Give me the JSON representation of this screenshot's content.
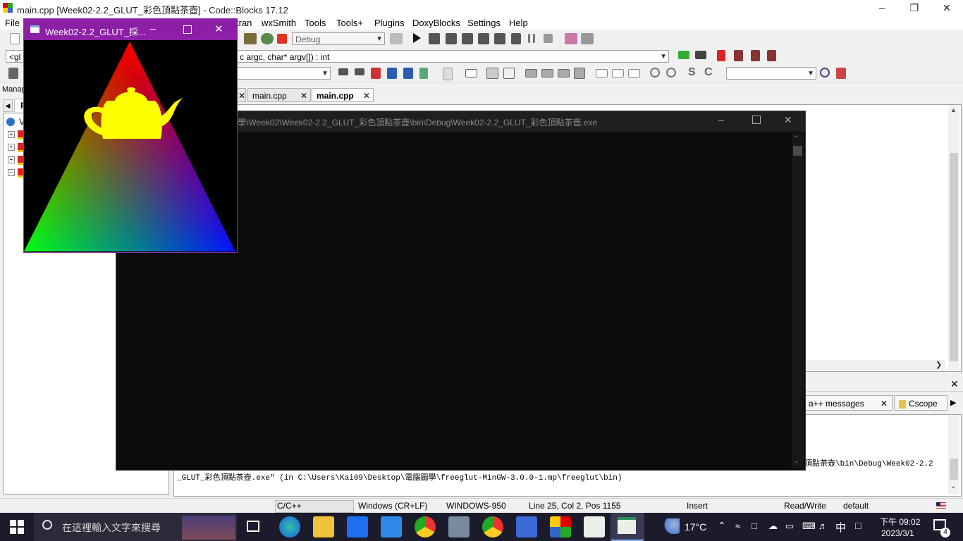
{
  "codeblocks": {
    "title": "main.cpp [Week02-2.2_GLUT_彩色頂點茶壺] - Code::Blocks 17.12",
    "menu": [
      "File",
      "tran",
      "wxSmith",
      "Tools",
      "Tools+",
      "Plugins",
      "DoxyBlocks",
      "Settings",
      "Help"
    ],
    "build_target": "Debug",
    "scope_left": "<gl",
    "function_signature": "c argc, char* argv[]) : int",
    "management_label": "Manag",
    "management_tab": "P",
    "workspace_label": "V",
    "tabs": [
      "main.cpp",
      "main.cpp"
    ],
    "logs_tabs": [
      "a++ messages",
      "Cscope"
    ],
    "log_line1": "頂點茶壺\\bin\\Debug\\Week02-2.2",
    "log_line2": "_GLUT_彩色頂點茶壺.exe\"  (in C:\\Users\\Kai09\\Desktop\\電腦圖學\\freeglut-MinGW-3.0.0-1.mp\\freeglut\\bin)",
    "status": {
      "language": "C/C++",
      "line_endings": "Windows (CR+LF)",
      "encoding": "WINDOWS-950",
      "position": "Line 25, Col 2, Pos 1155",
      "mode": "Insert",
      "access": "Read/Write",
      "profile": "default"
    }
  },
  "console": {
    "title": "電腦圖學\\Week02\\Week02-2.2_GLUT_彩色頂點茶壺\\bin\\Debug\\Week02-2.2_GLUT_彩色頂點茶壺.exe"
  },
  "glut": {
    "title": "Week02-2.2_GLUT_採...",
    "colors": {
      "top": "#ff0000",
      "left": "#00ff00",
      "right": "#0000ff",
      "teapot": "#ffff00"
    }
  },
  "taskbar": {
    "search_placeholder": "在這裡輸入文字來搜尋",
    "weather": "17°C",
    "ime": "中",
    "time": "下午 09:02",
    "date": "2023/3/1",
    "notifications": "4"
  },
  "colors": {
    "glut_titlebar": "#8c1fa6",
    "console_bg": "#0c0c0c",
    "taskbar": "#1b1b2c"
  }
}
